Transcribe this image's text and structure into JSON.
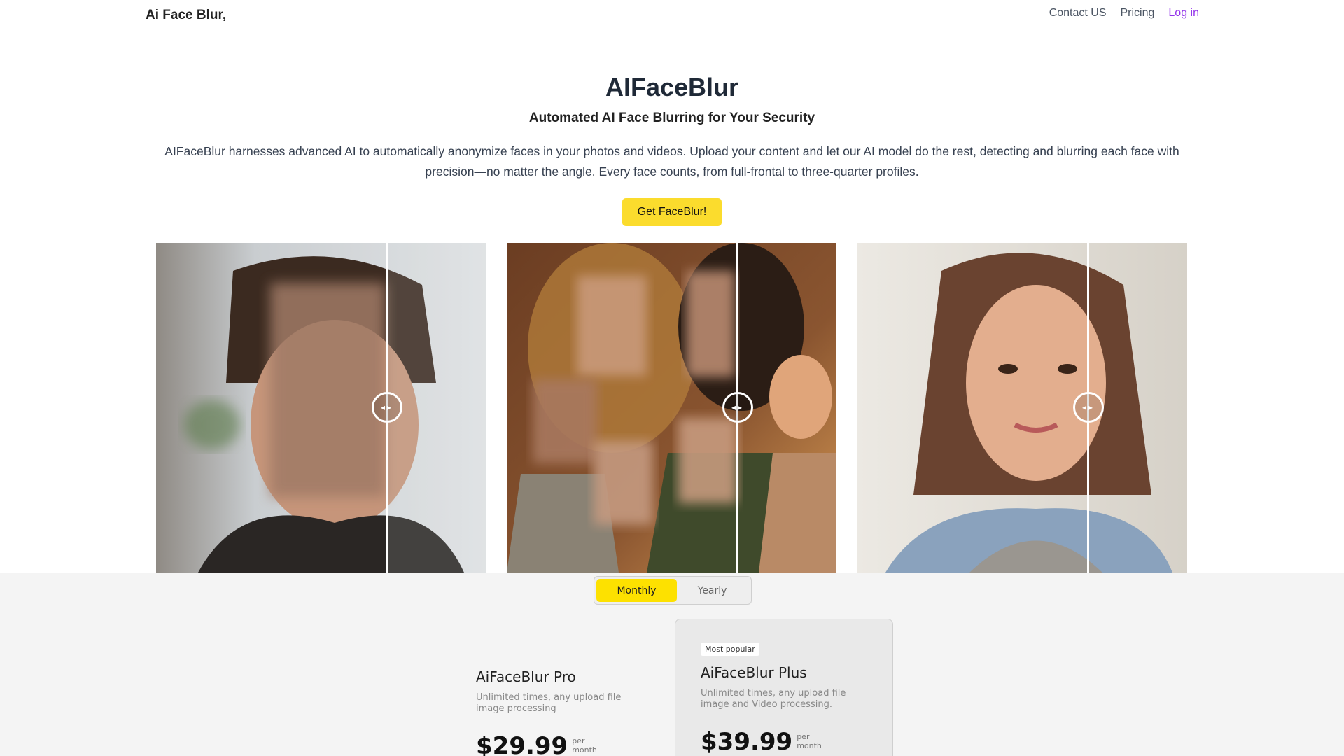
{
  "header": {
    "brand": "Ai Face Blur,",
    "nav": [
      {
        "label": "Contact US"
      },
      {
        "label": "Pricing"
      },
      {
        "label": "Log in"
      }
    ]
  },
  "hero": {
    "title": "AIFaceBlur",
    "subtitle": "Automated AI Face Blurring for Your Security",
    "description": "AIFaceBlur harnesses advanced AI to automatically anonymize faces in your photos and videos. Upload your content and let our AI model do the rest, detecting and blurring each face with precision—no matter the angle. Every face counts, from full-frontal to three-quarter profiles.",
    "cta_label": "Get FaceBlur!"
  },
  "comparisons": [
    {
      "subject": "man portrait",
      "colors": {
        "left": "#8f8a84",
        "mid": "#5b4a40",
        "right": "#d8dcdf"
      }
    },
    {
      "subject": "family group",
      "colors": {
        "left": "#7a4a2a",
        "mid": "#3e2a1c",
        "right": "#c98a4a"
      }
    },
    {
      "subject": "woman portrait",
      "colors": {
        "left": "#e9e6e0",
        "mid": "#7a5138",
        "right": "#d9d4cc"
      }
    }
  ],
  "pricing": {
    "toggle": {
      "monthly": "Monthly",
      "yearly": "Yearly",
      "selected": "Monthly"
    },
    "plans": [
      {
        "name": "AiFaceBlur Pro",
        "description": "Unlimited times, any upload file image processing",
        "price": "$29.99",
        "per": "per month",
        "badge": ""
      },
      {
        "name": "AiFaceBlur Plus",
        "description": "Unlimited times, any upload file image and Video processing.",
        "price": "$39.99",
        "per": "per month",
        "badge": "Most popular"
      }
    ]
  },
  "colors": {
    "accent": "#fbdc2d",
    "toggle_active": "#fde100",
    "login_link": "#9333ea",
    "pricing_bg": "#f4f4f4"
  }
}
